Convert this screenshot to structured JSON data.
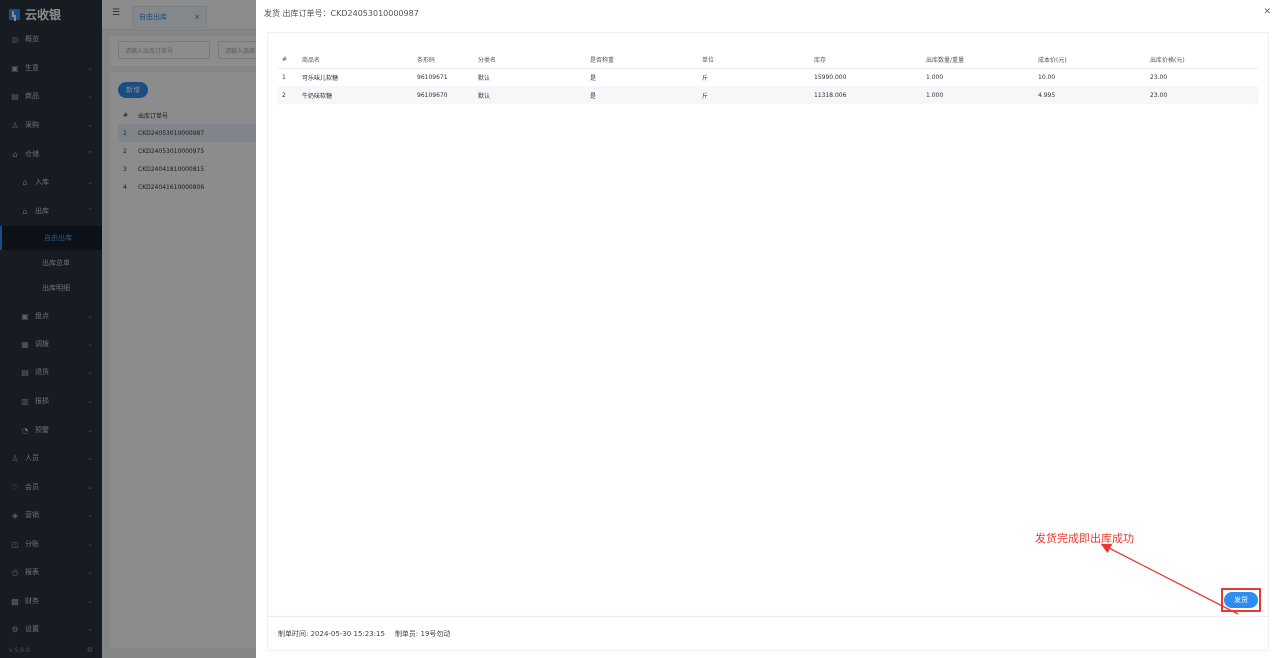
{
  "app": {
    "logo_text": "云收银",
    "version": "v 5.9.0"
  },
  "sidebar": {
    "items": [
      {
        "label": "概览",
        "icon": "dashboard-icon"
      },
      {
        "label": "生意",
        "icon": "business-icon"
      },
      {
        "label": "商品",
        "icon": "goods-icon"
      },
      {
        "label": "采购",
        "icon": "purchase-icon"
      },
      {
        "label": "仓储",
        "icon": "warehouse-icon"
      },
      {
        "label": "入库",
        "icon": "inbound-icon"
      },
      {
        "label": "出库",
        "icon": "outbound-icon"
      },
      {
        "label": "自由出库"
      },
      {
        "label": "出库总单"
      },
      {
        "label": "出库明细"
      },
      {
        "label": "盘点",
        "icon": "inventory-icon"
      },
      {
        "label": "调拨",
        "icon": "transfer-icon"
      },
      {
        "label": "退货",
        "icon": "return-icon"
      },
      {
        "label": "报损",
        "icon": "loss-icon"
      },
      {
        "label": "预警",
        "icon": "alert-icon"
      },
      {
        "label": "人员",
        "icon": "staff-icon"
      },
      {
        "label": "会员",
        "icon": "member-icon"
      },
      {
        "label": "营销",
        "icon": "marketing-icon"
      },
      {
        "label": "分账",
        "icon": "split-icon"
      },
      {
        "label": "报表",
        "icon": "report-icon"
      },
      {
        "label": "财务",
        "icon": "finance-icon"
      },
      {
        "label": "设置",
        "icon": "settings-icon"
      }
    ]
  },
  "topbar": {
    "tab_label": "自由出库"
  },
  "filters": {
    "order_placeholder": "请输入出库订单号",
    "other_placeholder": "请输入选择"
  },
  "list": {
    "add_label": "新增",
    "header_index": "#",
    "header_order": "出库订单号",
    "rows": [
      {
        "index": "1",
        "order": "CKD24053010000987"
      },
      {
        "index": "2",
        "order": "CKD24053010000975"
      },
      {
        "index": "3",
        "order": "CKD24041810000815"
      },
      {
        "index": "4",
        "order": "CKD24041610000806"
      }
    ]
  },
  "drawer": {
    "title": "发货 出库订单号：CKD24053010000987",
    "columns": [
      "#",
      "商品名",
      "条形码",
      "分类名",
      "是否称重",
      "单位",
      "库存",
      "出库数量/重量",
      "成本价(元)",
      "出库价格(元)"
    ],
    "rows": [
      [
        "1",
        "可乐味儿软糖",
        "96109671",
        "默认",
        "是",
        "斤",
        "15990.000",
        "1.000",
        "10.00",
        "23.00"
      ],
      [
        "2",
        "牛奶味软糖",
        "96109670",
        "默认",
        "是",
        "斤",
        "11318.006",
        "1.000",
        "4.995",
        "23.00"
      ]
    ],
    "footer": {
      "created_time": "制单时间: 2024-05-30 15:23:15",
      "creator": "制单员: 19号勿动"
    },
    "ship_label": "发货"
  },
  "annotation": {
    "text": "发货完成即出库成功",
    "color": "#e8392f"
  }
}
